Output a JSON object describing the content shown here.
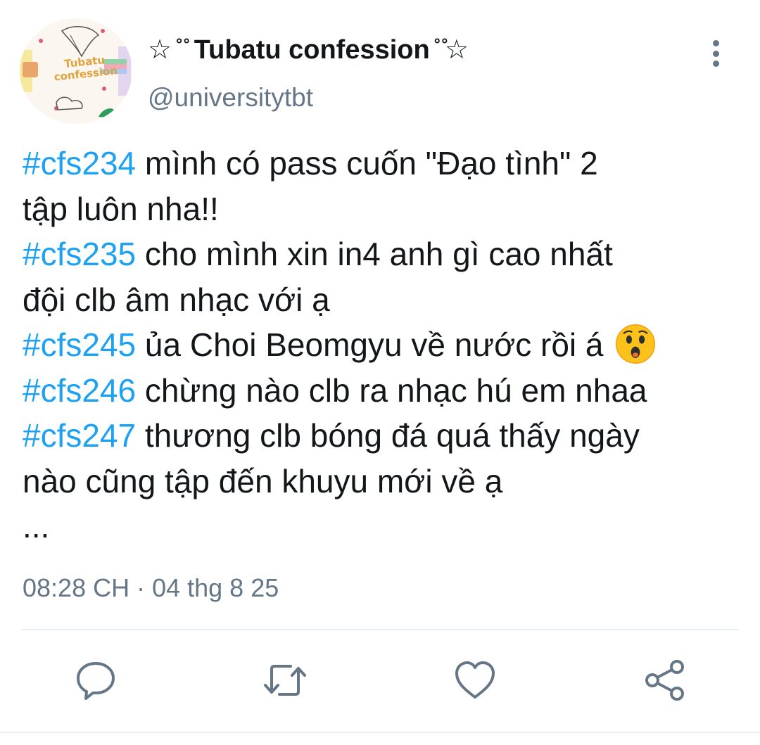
{
  "author": {
    "display_name": "☆ ̊ ̊ Tubatu confession ̊ ̊☆",
    "handle": "@universitytbt",
    "avatar_text": "Tubatu confession",
    "avatar_icon": "tubatu-logo"
  },
  "tweet": {
    "lines": [
      {
        "tag": "#cfs234",
        "text": " mình có pass cuốn \"Đạo tình\" 2"
      },
      {
        "tag": "",
        "text": "tập luôn nha!!"
      },
      {
        "tag": "#cfs235",
        "text": " cho mình xin in4 anh gì cao nhất"
      },
      {
        "tag": "",
        "text": "đội clb âm nhạc với ạ"
      },
      {
        "tag": "#cfs245",
        "text": " ủa Choi Beomgyu về nước rồi á",
        "emoji": "astonished-face"
      },
      {
        "tag": "#cfs246",
        "text": " chừng nào clb ra nhạc hú em nhaa"
      },
      {
        "tag": "#cfs247",
        "text": " thương clb bóng đá quá thấy ngày"
      },
      {
        "tag": "",
        "text": "nào cũng tập đến khuyu mới về ạ"
      }
    ],
    "ellipsis": "...",
    "timestamp": "08:28 CH · 04 thg 8 25"
  },
  "actions": [
    "reply-icon",
    "retweet-icon",
    "like-icon",
    "share-icon"
  ],
  "colors": {
    "hashtag": "#1da1f2",
    "secondary_text": "#657786",
    "primary_text": "#14171a",
    "divider": "#e6ecf0"
  }
}
